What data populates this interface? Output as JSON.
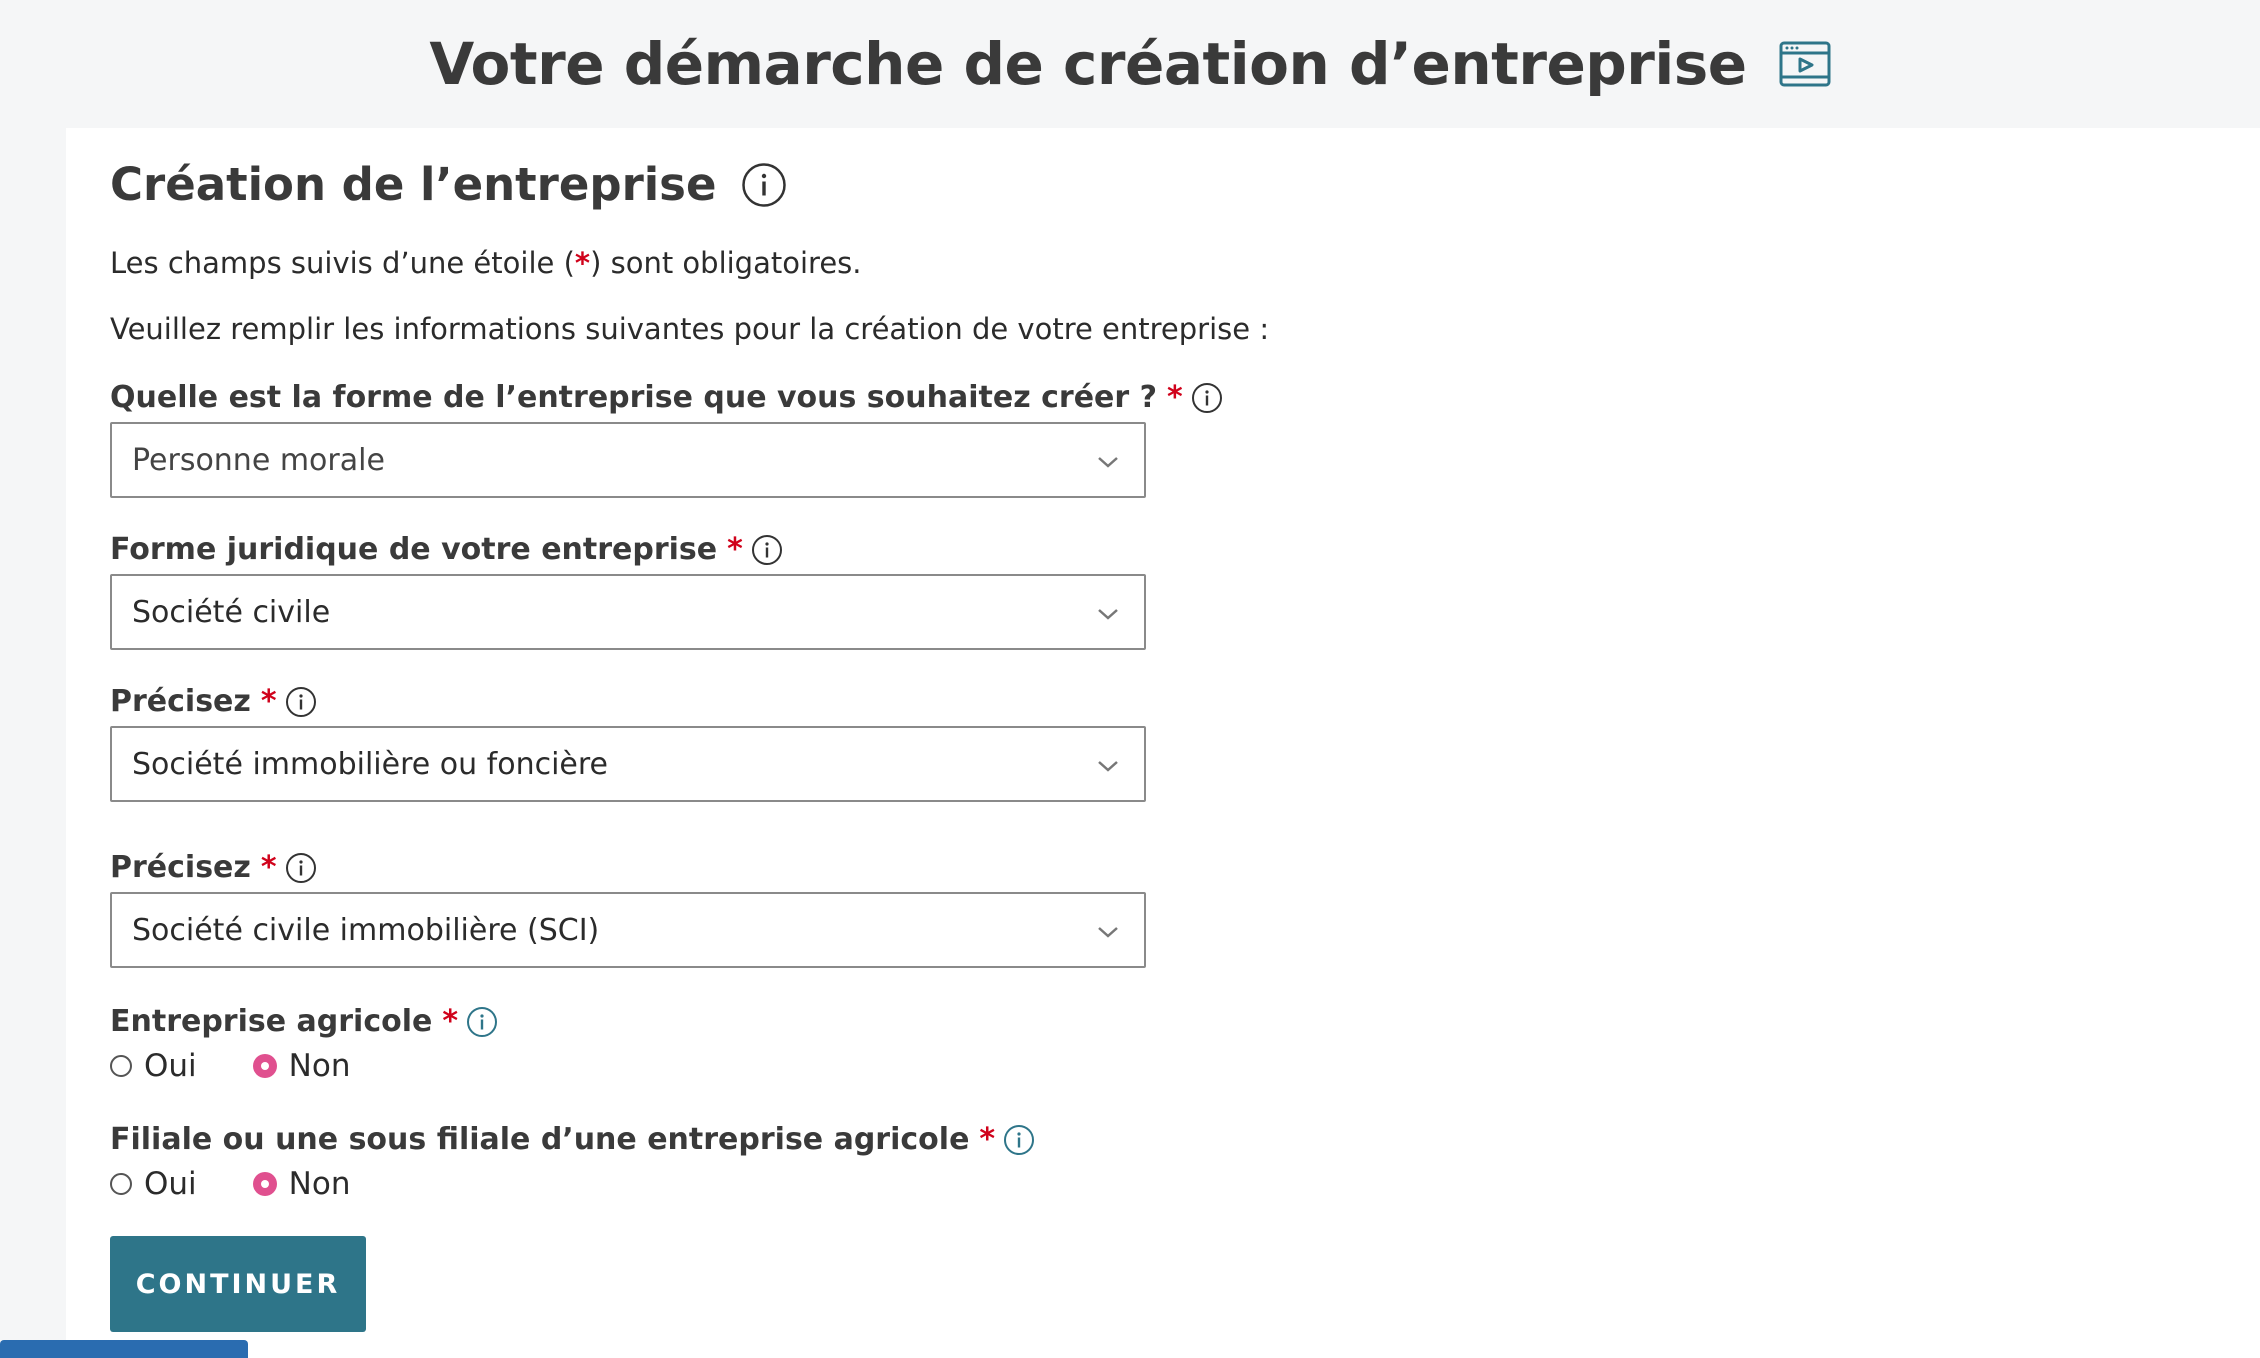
{
  "header": {
    "title": "Votre démarche de création d’entreprise",
    "video_icon": "video-tutorial-icon"
  },
  "section": {
    "title": "Création de l’entreprise",
    "info_icon": "info-icon"
  },
  "intro": {
    "required_prefix": "Les champs suivis d’une étoile (",
    "required_star": "*",
    "required_suffix": ") sont obligatoires.",
    "instructions": "Veuillez remplir les informations suivantes pour la création de votre entreprise :"
  },
  "fields": {
    "forme": {
      "label": "Quelle est la forme de l’entreprise que vous souhaitez créer ?",
      "required": "*",
      "value": "Personne morale"
    },
    "forme_juridique": {
      "label": "Forme juridique de votre entreprise",
      "required": "*",
      "value": "Société civile"
    },
    "precisez_1": {
      "label": "Précisez",
      "required": "*",
      "value": "Société immobilière ou foncière"
    },
    "precisez_2": {
      "label": "Précisez",
      "required": "*",
      "value": "Société civile immobilière (SCI)"
    },
    "agricole": {
      "label": "Entreprise agricole",
      "required": "*",
      "options": [
        "Oui",
        "Non"
      ],
      "selected": "Non"
    },
    "filiale": {
      "label": "Filiale ou une sous filiale d’une entreprise agricole",
      "required": "*",
      "options": [
        "Oui",
        "Non"
      ],
      "selected": "Non"
    }
  },
  "actions": {
    "continue_label": "CONTINUER"
  },
  "colors": {
    "accent": "#2e7589",
    "required": "#d0021b",
    "radio_selected": "#e0508f",
    "info_teal": "#2e7589"
  }
}
